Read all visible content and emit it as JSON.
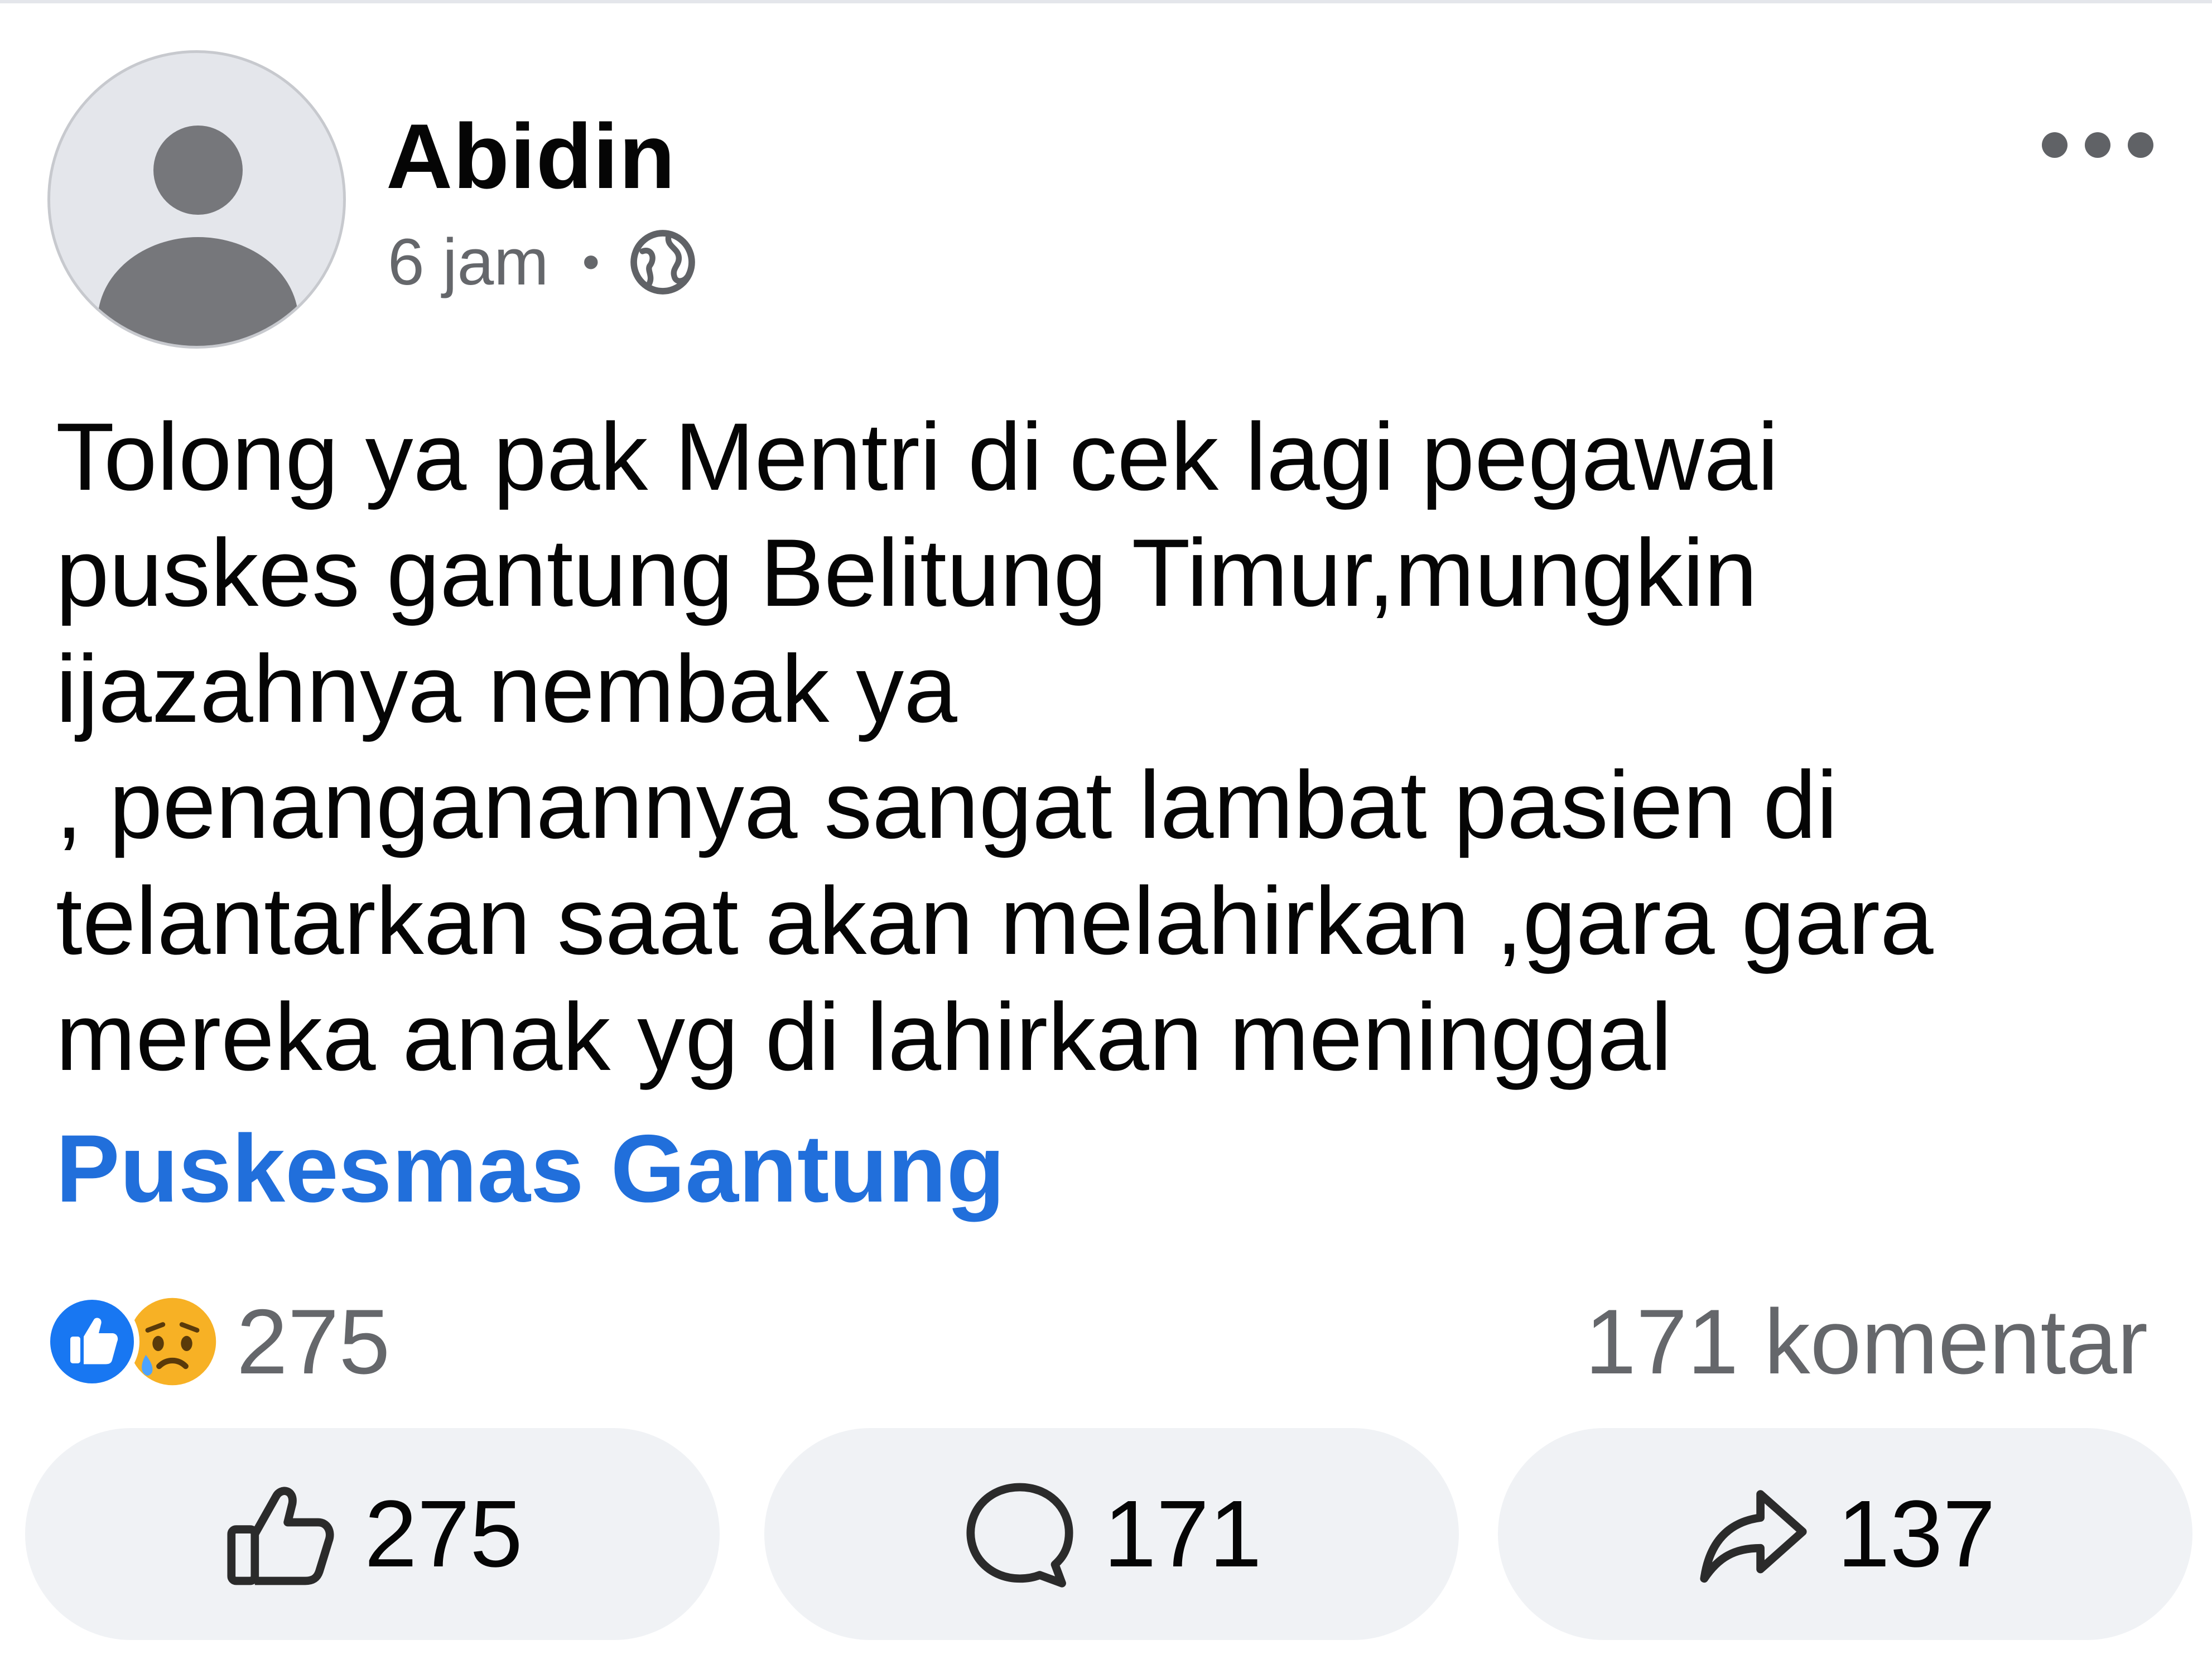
{
  "post": {
    "author": "Abidin",
    "time": "6 jam",
    "separator": "•",
    "audience_icon": "globe-icon",
    "menu_icon": "more-options-icon",
    "text": "Tolong ya pak Mentri di cek lagi pegawai\npuskes gantung Belitung Timur,mungkin\nijazahnya nembak ya\n, penanganannya sangat lambat pasien di\ntelantarkan saat akan melahirkan ,gara gara\nmereka anak yg di lahirkan meninggal",
    "tag": "Puskesmas Gantung"
  },
  "summary": {
    "reaction_icons": [
      "like-reaction-icon",
      "sad-reaction-icon"
    ],
    "reaction_count": "275",
    "comments_label": "171 komentar"
  },
  "actions": {
    "like": {
      "icon": "thumbs-up-icon",
      "count": "275"
    },
    "comment": {
      "icon": "comment-bubble-icon",
      "count": "171"
    },
    "share": {
      "icon": "share-arrow-icon",
      "count": "137"
    }
  },
  "colors": {
    "link": "#216fdb",
    "like_blue": "#1877f2",
    "secondary_text": "#65676b",
    "button_bg": "#f0f2f5"
  }
}
